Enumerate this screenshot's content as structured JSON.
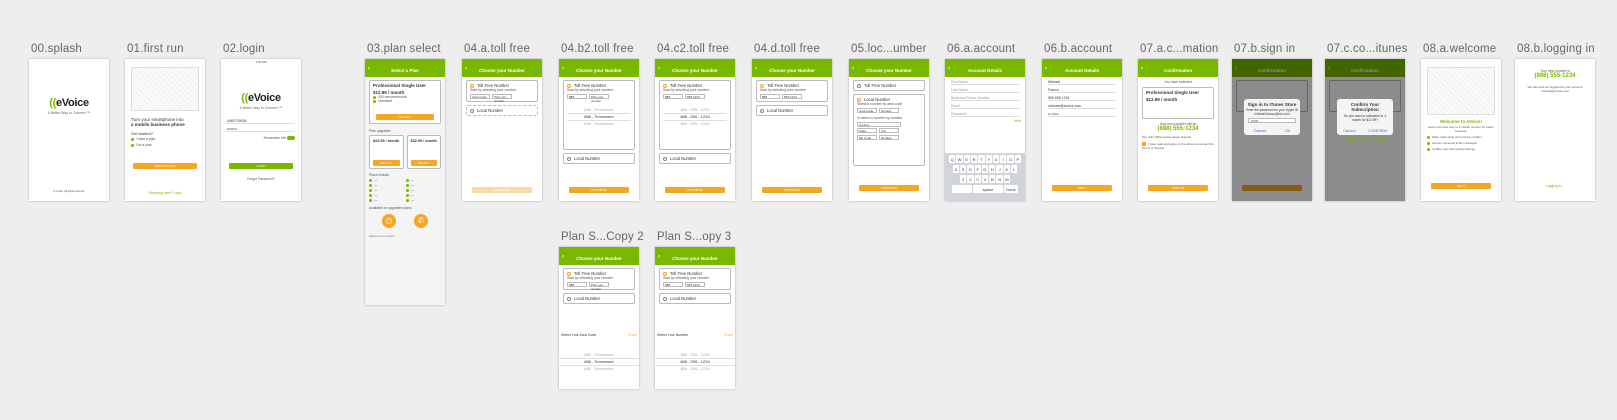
{
  "artboards": {
    "splash": {
      "label": "00.splash",
      "logo": "eVoice",
      "logo_mark": "((",
      "tagline": "A Better Way to Connect ™",
      "footer": "© eVoice. All rights reserved."
    },
    "first_run": {
      "label": "01.first run",
      "headline_1": "Turn your smartphone into",
      "headline_2": "a mobile business phone",
      "get_started": "Get started?",
      "opt_1": "I have a plan",
      "opt_2": "Get a plan",
      "cta": "SIGN UP NOW!",
      "link": "Returning user? Login"
    },
    "login": {
      "label": "02.login",
      "time": "1:00 PM",
      "logo": "eVoice",
      "tagline": "A Better Way to Connect ™",
      "phone": "9462729534",
      "password": "••••••••",
      "remember": "Remember Me",
      "cta": "LOGIN",
      "forgot": "Forgot Password?"
    },
    "plan_select": {
      "label": "03.plan select",
      "nav": "Select a Plan",
      "plan_title": "Professional Single User",
      "price": "$12.99 / month",
      "feat_1": "300 minutes/month",
      "feat_2": "Unlimited",
      "select": "SELECT",
      "upgrades": "Plan upgrades",
      "price_b": "$22.99 / month",
      "price_c": "$32.99 / month",
      "features_title": "Plans include",
      "available": "Available on upgrades plans",
      "note": "Welcome to eVoice"
    },
    "toll_free_a": {
      "label": "04.a.toll free",
      "nav": "Choose your Number",
      "toll_free": "Toll Free Number",
      "start_by": "Start by selecting your number",
      "area_code": "Area Code",
      "number_placeholder": "Pick your number",
      "local": "Local Number",
      "cta": "CONTINUE"
    },
    "toll_free_b2": {
      "label": "04.b2.toll free",
      "nav": "Choose your Number",
      "toll_free": "Toll Free Number",
      "start_by": "Start by selecting your number",
      "area": "888",
      "number_placeholder": "Pick your number",
      "pick_1": "888 - Tennessee",
      "pick_2": "888 - Tennessee",
      "pick_3": "888 - Tennessee",
      "local": "Local Number",
      "cta": "CONTINUE"
    },
    "toll_free_c2": {
      "label": "04.c2.toll free",
      "nav": "Choose your Number",
      "toll_free": "Toll Free Number",
      "start_by": "Start by selecting your number",
      "area": "888",
      "number": "555-1234",
      "pick_1": "888 - 555 - 1234",
      "pick_2": "888 - 555 - 1234",
      "pick_3": "888 - 555 - 1234",
      "local": "Local Number",
      "cta": "CONTINUE"
    },
    "toll_free_d": {
      "label": "04.d.toll free",
      "nav": "Choose your Number",
      "toll_free": "Toll Free Number",
      "start_by": "Start by selecting your number",
      "area": "888",
      "number": "555-1234",
      "local": "Local Number",
      "cta": "CONTINUE"
    },
    "local_number": {
      "label": "05.loc...umber",
      "nav": "Choose your Number",
      "toll_free": "Toll Free Number",
      "local": "Local Number",
      "by_area": "Select a number by area code",
      "area_code": "Area Code",
      "number_placeholder": "Number",
      "by_location": "or select a number by location",
      "country": "Country",
      "state": "State",
      "city": "City",
      "zip": "Zip Code",
      "number2": "Number",
      "cta": "CONTINUE"
    },
    "account_a": {
      "label": "06.a.account",
      "nav": "Account Details",
      "f1": "First Name",
      "f2": "Last Name",
      "f3": "Business Phone Number",
      "f4": "Email",
      "f5": "Password",
      "next": "Next",
      "keys_row1": [
        "Q",
        "W",
        "E",
        "R",
        "T",
        "Y",
        "U",
        "I",
        "O",
        "P"
      ],
      "keys_row2": [
        "A",
        "S",
        "D",
        "F",
        "G",
        "H",
        "J",
        "K",
        "L"
      ],
      "keys_row3": [
        "Z",
        "X",
        "C",
        "V",
        "B",
        "N",
        "M"
      ],
      "space": "space",
      "done": "Done"
    },
    "account_b": {
      "label": "06.b.account",
      "nav": "Account Details",
      "f1": "Michael",
      "f2": "Franco",
      "f3": "555 555 1234",
      "f4": "michael@evoice.com",
      "f5": "•• ••••••",
      "cta": "NEXT"
    },
    "confirmation": {
      "label": "07.a.c...mation",
      "nav": "Confirmation",
      "chosen": "You have selected",
      "plan_title": "Professional Single User",
      "price": "$12.99 / month",
      "your_number": "Your new number will be",
      "number": "(888) 555-1234",
      "pay_note": "Pay with 100% secure Apple Support",
      "agree": "I have read and agree to the above terms and the Terms of Service",
      "cta": "SIGN UP"
    },
    "sign_in": {
      "label": "07.b.sign in",
      "nav": "Confirmation",
      "dialog_title": "Sign in to iTunes Store",
      "dialog_body": "Enter the password for your Apple ID",
      "dialog_id": "michael.franco@me.com",
      "dialog_pw": "••••••",
      "cancel": "Cancel",
      "ok": "OK"
    },
    "confirm_sub": {
      "label": "07.c.co...itunes",
      "nav": "Confirmation",
      "dialog_title": "Confirm Your Subscription",
      "dialog_body": "Do you want to subscribe to 1 month for $12.99?",
      "cancel": "Cancel",
      "confirm": "CONFIRM",
      "number": "(888) 555-1234"
    },
    "welcome": {
      "label": "08.a.welcome",
      "title": "Welcome to eVoice!",
      "sub": "Here's the best way to a mobile number for better business",
      "b1": "Make calls using your eVoice number",
      "b2": "Access voicemail & fax messages",
      "b3": "Update your call routing settings",
      "cta": "NEXT"
    },
    "logging_in": {
      "label": "08.b.logging in",
      "heading": "Your new number is",
      "number": "(888) 555-1234",
      "sub": "We will send we logged into your account",
      "email": "michael@evoice.com",
      "loading": "Logging in..."
    },
    "copy2": {
      "label": "Plan S...Copy 2",
      "nav": "Choose your Number",
      "toll_free": "Toll Free Number",
      "start_by": "Start by selecting your number",
      "area": "888",
      "number_placeholder": "Pick your number",
      "local": "Local Number",
      "picker_title": "Select Your Area Code",
      "done": "Done",
      "pick_1": "888 - Tennessee",
      "pick_2": "888 - Tennessee",
      "pick_3": "888 - Tennessee"
    },
    "copy3": {
      "label": "Plan S...opy 3",
      "nav": "Choose your Number",
      "toll_free": "Toll Free Number",
      "start_by": "Start by selecting your number",
      "area": "888",
      "number": "555-1234",
      "local": "Local Number",
      "picker_title": "Select Your Number",
      "done": "Done",
      "pick_1": "888 - 555 - 1234",
      "pick_2": "888 - 555 - 1234",
      "pick_3": "888 - 555 - 1234"
    }
  }
}
